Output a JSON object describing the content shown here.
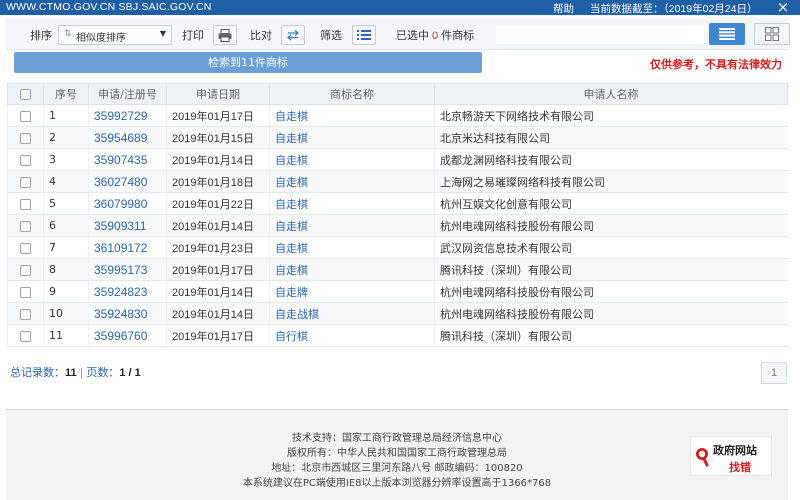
{
  "header": {
    "site_domains": "WWW.CTMO.GOV.CN SBJ.SAIC.GOV.CN",
    "help_label": "帮助",
    "data_date_label": "当前数据截至：",
    "data_date_value": "（2019年02月24日）",
    "close_glyph": "×"
  },
  "toolbar": {
    "sort_label": "排序",
    "sort_selected": "相似度排序",
    "print_label": "打印",
    "compare_label": "比对",
    "filter_label": "筛选",
    "selected_prefix": "已选中",
    "selected_count": "0",
    "selected_suffix": "件商标",
    "search_placeholder": ""
  },
  "result_banner": "检索到11件商标",
  "disclaimer": "仅供参考，不具有法律效力",
  "table": {
    "headers": [
      "序号",
      "申请/注册号",
      "申请日期",
      "商标名称",
      "申请人名称"
    ],
    "rows": [
      {
        "no": "1",
        "reg": "35992729",
        "date": "2019年01月17日",
        "name": "自走棋",
        "applicant": "北京畅游天下网络技术有限公司"
      },
      {
        "no": "2",
        "reg": "35954689",
        "date": "2019年01月15日",
        "name": "自走棋",
        "applicant": "北京米达科技有限公司"
      },
      {
        "no": "3",
        "reg": "35907435",
        "date": "2019年01月14日",
        "name": "自走棋",
        "applicant": "成都龙渊网络科技有限公司"
      },
      {
        "no": "4",
        "reg": "36027480",
        "date": "2019年01月18日",
        "name": "自走棋",
        "applicant": "上海网之易璀璨网络科技有限公司"
      },
      {
        "no": "5",
        "reg": "36079980",
        "date": "2019年01月22日",
        "name": "自走棋",
        "applicant": "杭州互娱文化创意有限公司"
      },
      {
        "no": "6",
        "reg": "35909311",
        "date": "2019年01月14日",
        "name": "自走棋",
        "applicant": "杭州电魂网络科技股份有限公司"
      },
      {
        "no": "7",
        "reg": "36109172",
        "date": "2019年01月23日",
        "name": "自走棋",
        "applicant": "武汉网资信息技术有限公司"
      },
      {
        "no": "8",
        "reg": "35995173",
        "date": "2019年01月17日",
        "name": "自走棋",
        "applicant": "腾讯科技（深圳）有限公司"
      },
      {
        "no": "9",
        "reg": "35924823",
        "date": "2019年01月14日",
        "name": "自走牌",
        "applicant": "杭州电魂网络科技股份有限公司"
      },
      {
        "no": "10",
        "reg": "35924830",
        "date": "2019年01月14日",
        "name": "自走战棋",
        "applicant": "杭州电魂网络科技股份有限公司"
      },
      {
        "no": "11",
        "reg": "35996760",
        "date": "2019年01月17日",
        "name": "自行棋",
        "applicant": "腾讯科技（深圳）有限公司"
      }
    ]
  },
  "paging": {
    "total_label": "总记录数：",
    "total_value": "11",
    "separator": "|",
    "pages_label": "页数：",
    "pages_value": "1 / 1",
    "page_button": "1"
  },
  "footer": {
    "lines": [
      "技术支持：国家工商行政管理总局经济信息中心",
      "版权所有：中华人民共和国国家工商行政管理总局",
      "地址：北京市西城区三里河东路八号  邮政编码：100820",
      "本系统建议在PC端使用IE8以上版本浏览器分辨率设置高于1366*768"
    ],
    "badge_line1": "政府网站",
    "badge_line2": "找错"
  },
  "colors": {
    "header_bg": "#1f5fa6",
    "banner_bg": "#6c9fd6",
    "link": "#2a66b3",
    "alert_red": "#d71e1e",
    "count_orange": "#e03a1e",
    "view_active": "#3f87d1"
  },
  "icons": [
    "close-icon",
    "sort-order-icon",
    "dropdown-arrow-icon",
    "printer-icon",
    "compare-icon",
    "filter-list-icon",
    "list-view-icon",
    "grid-view-icon",
    "magnifier-icon"
  ]
}
